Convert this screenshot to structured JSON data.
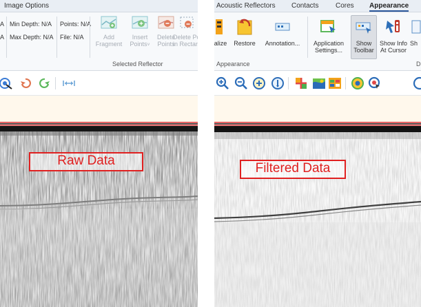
{
  "left_panel": {
    "ribbon": {
      "header": "Image Options",
      "col1": [
        "A",
        "A"
      ],
      "min_depth": "Min Depth: N/A",
      "max_depth": "Max Depth: N/A",
      "points": "Points: N/A",
      "file": "File: N/A",
      "buttons": [
        {
          "label1": "Add",
          "label2": "Fragment",
          "icon": "add-fragment-icon"
        },
        {
          "label1": "Insert",
          "label2": "Points",
          "icon": "insert-points-icon"
        },
        {
          "label1": "Delete",
          "label2": "Points",
          "icon": "delete-points-icon"
        },
        {
          "label1": "Delete Po",
          "label2": "in Rectan",
          "icon": "delete-points-rect-icon"
        }
      ],
      "group_label": "Selected Reflector"
    },
    "tools": [
      "target-icon",
      "undo-icon",
      "redo-icon",
      "fit-width-icon"
    ],
    "label": "Raw Data"
  },
  "right_panel": {
    "tabs": [
      "Acoustic Reflectors",
      "Contacts",
      "Cores",
      "Appearance"
    ],
    "active_tab": "Appearance",
    "ribbon": {
      "buttons": [
        {
          "label1": "alize",
          "label2": "",
          "icon": "normalize-icon"
        },
        {
          "label1": "Restore",
          "label2": "",
          "icon": "restore-icon"
        },
        {
          "label1": "Annotation...",
          "label2": "",
          "icon": "annotation-icon"
        },
        {
          "label1": "Application",
          "label2": "Settings...",
          "icon": "application-settings-icon"
        },
        {
          "label1": "Show",
          "label2": "Toolbar",
          "icon": "show-toolbar-icon",
          "pressed": true
        },
        {
          "label1": "Show Info",
          "label2": "At Cursor",
          "icon": "show-info-cursor-icon"
        },
        {
          "label1": "Sh",
          "label2": "",
          "icon": "show-icon"
        }
      ],
      "group_label": "Appearance",
      "group_label_2": "D"
    },
    "tools": [
      "zoom-in-icon",
      "zoom-out-icon",
      "add-circle-icon",
      "info-circle-icon",
      "move-icon",
      "map-icon",
      "grid-icon",
      "target-icon",
      "cursor-target-icon",
      "circle-icon"
    ],
    "label": "Filtered Data"
  }
}
